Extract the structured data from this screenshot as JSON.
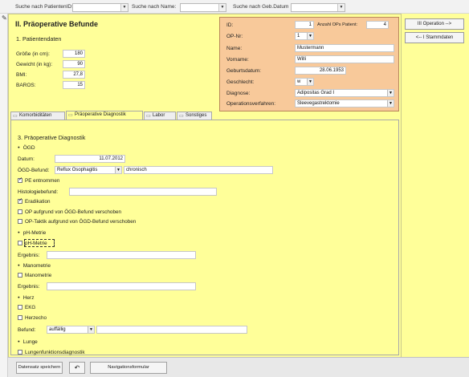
{
  "search": {
    "patient_id_label": "Suche nach PatientenID:",
    "name_label": "Suche nach Name:",
    "dob_label": "Suche nach Geb.Datum"
  },
  "header": {
    "title": "II. Präoperative Befunde",
    "patient_section": "1. Patientendaten"
  },
  "vitals": [
    {
      "label": "Größe (in cm):",
      "value": "180"
    },
    {
      "label": "Gewicht (in kg):",
      "value": "90"
    },
    {
      "label": "BMI:",
      "value": "27,8"
    },
    {
      "label": "BAROS:",
      "value": "15"
    }
  ],
  "patient": {
    "id_label": "ID:",
    "id_value": "1",
    "ops_label": "Anzahl OPs Patient:",
    "ops_value": "4",
    "opnr_label": "OP-Nr:",
    "opnr_value": "1",
    "name_label": "Name:",
    "name_value": "Mustermann",
    "vorname_label": "Vorname:",
    "vorname_value": "Willi",
    "geb_label": "Geburtsdatum:",
    "geb_value": "28.06.1953",
    "geschlecht_label": "Geschlecht:",
    "geschlecht_value": "w",
    "diagnose_label": "Diagnose:",
    "diagnose_value": "Adipositas Grad I",
    "opverf_label": "Operationsverfahren:",
    "opverf_value": "Sleevegastrektomie"
  },
  "sidebar": {
    "next_button": "III Operation -->",
    "prev_button": "<-- I Stammdaten"
  },
  "tabs": [
    "Komorbiditäten",
    "Präoperative Diagnostik",
    "Labor",
    "Sonstiges"
  ],
  "diagnostik": {
    "section_title": "3. Präoperative Diagnostik",
    "ogd_heading": "ÖGD",
    "datum_label": "Datum:",
    "datum_value": "11.07.2012",
    "ogd_befund_label": "ÖGD-Befund:",
    "ogd_befund_value": "Reflux Ösophagitis",
    "ogd_befund_extra": "chronisch",
    "pe_label": "PE entnommen",
    "histo_label": "Histologiebefund:",
    "eradikation_label": "Eradikation",
    "op_verschoben_label": "OP aufgrund von ÖGD-Befund verschoben",
    "op_taktik_label": "OP-Taktik aufgrund von ÖGD-Befund verschoben",
    "ph_heading": "pH-Metrie",
    "ph_check_label": "pH-Metrie",
    "ergebnis_label": "Ergebnis:",
    "mano_heading": "Manometrie",
    "mano_check_label": "Manometrie",
    "ergebnis2_label": "Ergebnis:",
    "herz_heading": "Herz",
    "ekg_label": "EKG",
    "herzecho_label": "Herzecho",
    "befund_label": "Befund:",
    "befund_value": "auffällig",
    "lunge_heading": "Lunge",
    "lunge_check_label": "Lungenfunktionsdiagnostik"
  },
  "bottom": {
    "save_button": "Datensatz speichern",
    "undo_button": "↶",
    "nav_button": "Navigationsformular"
  }
}
